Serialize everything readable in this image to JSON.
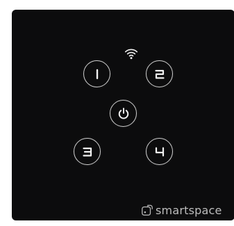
{
  "buttons": {
    "one": {
      "label": "1"
    },
    "two": {
      "label": "2"
    },
    "three": {
      "label": "3"
    },
    "four": {
      "label": "4"
    },
    "power": {
      "icon": "power-icon"
    }
  },
  "status": {
    "icon": "wifi-icon"
  },
  "brand": {
    "name": "smartspace",
    "icon": "smartspace-logo-icon"
  },
  "colors": {
    "panel": "#0c0c0d",
    "glyph": "#f2f2f2",
    "ring": "#cfcfcf",
    "brand_text": "#bdbdbd"
  }
}
